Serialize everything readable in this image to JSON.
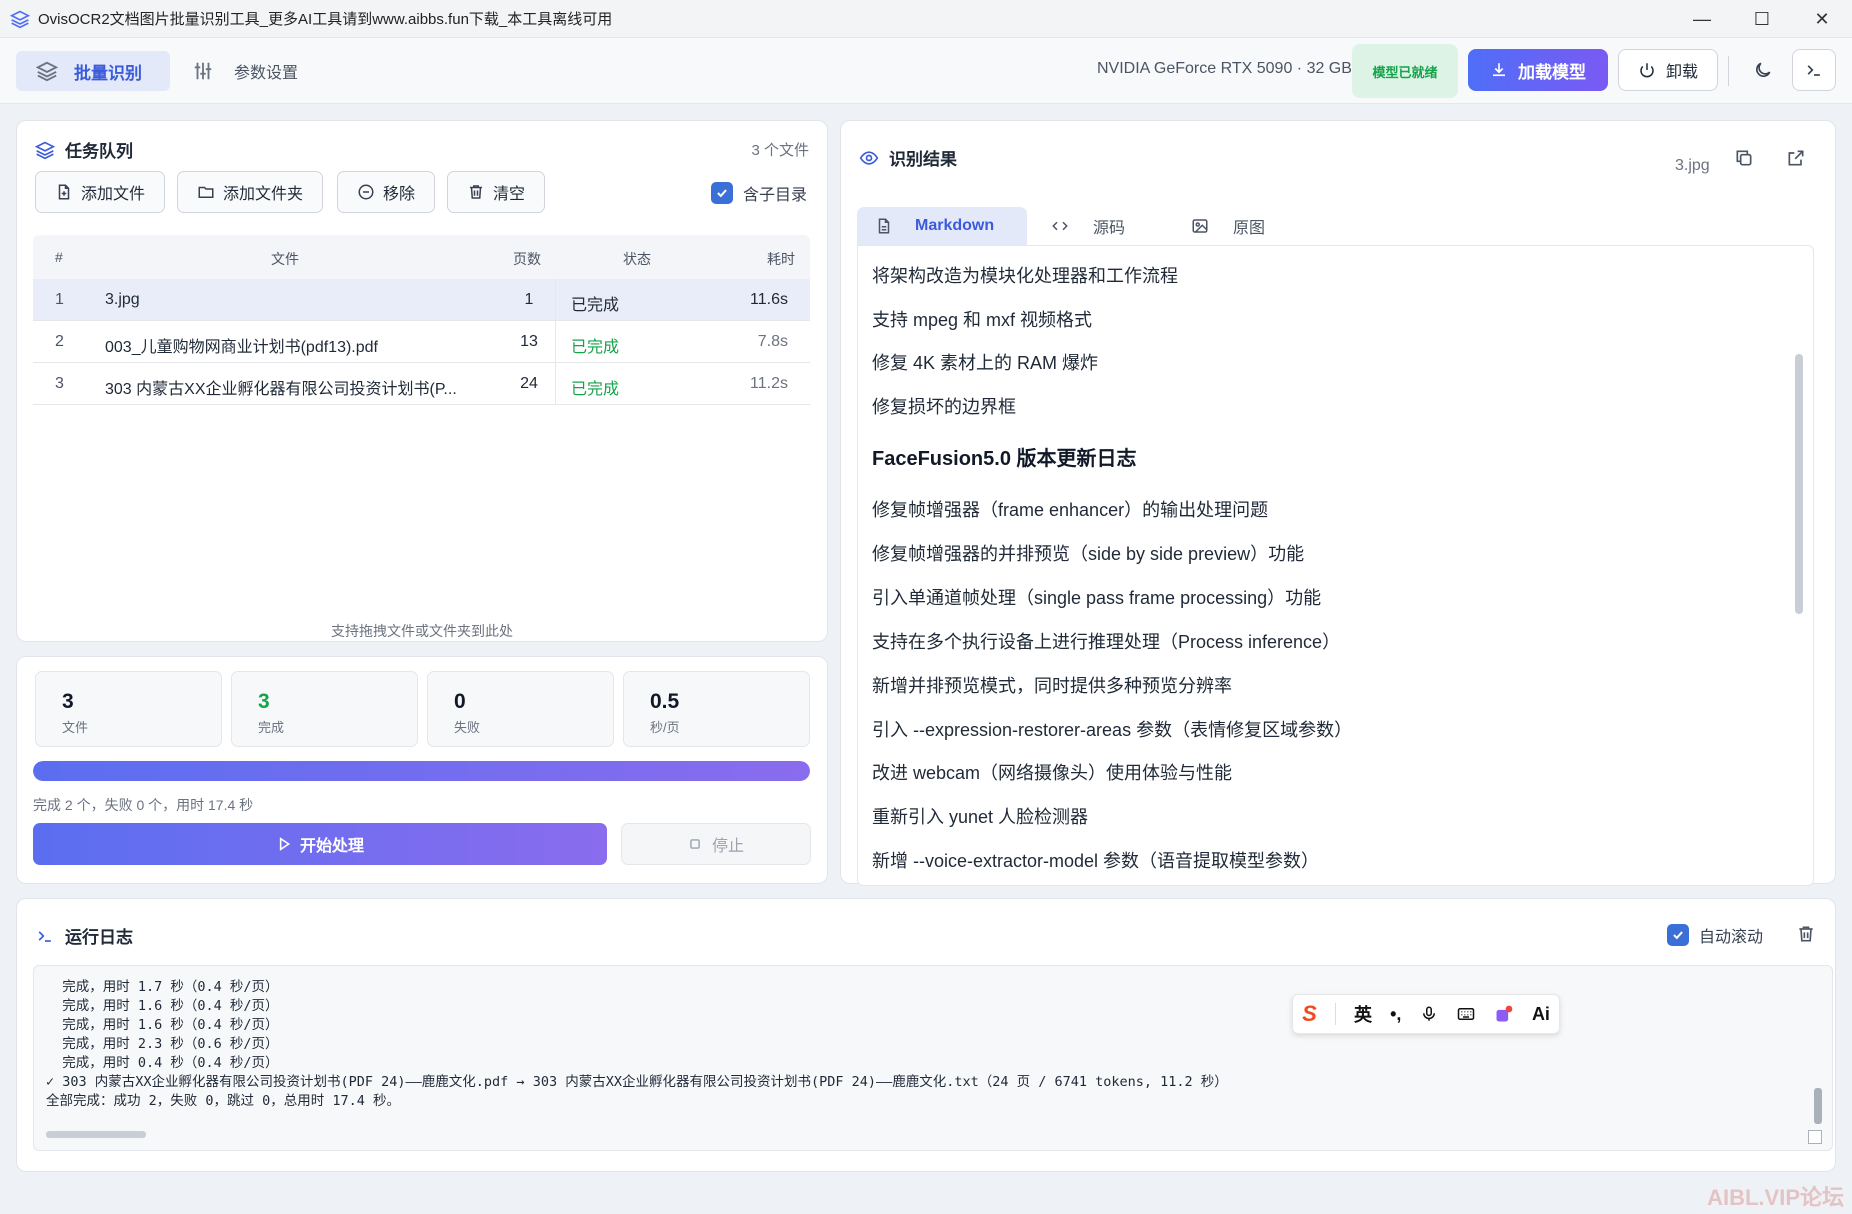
{
  "window": {
    "title": "OvisOCR2文档图片批量识别工具_更多AI工具请到www.aibbs.fun下载_本工具离线可用"
  },
  "topbar": {
    "nav": [
      {
        "label": "批量识别",
        "icon": "layers-icon",
        "active": true
      },
      {
        "label": "参数设置",
        "icon": "sliders-icon",
        "active": false
      }
    ],
    "gpu_info": "NVIDIA GeForce RTX 5090 · 32 GB",
    "model_status": "模型已就绪",
    "load_model_label": "加载模型",
    "unload_label": "卸载"
  },
  "queue": {
    "title": "任务队列",
    "file_count": "3 个文件",
    "buttons": {
      "add_file": "添加文件",
      "add_folder": "添加文件夹",
      "remove": "移除",
      "clear": "清空"
    },
    "include_subdirs": {
      "label": "含子目录",
      "checked": true
    },
    "columns": {
      "idx": "#",
      "file": "文件",
      "pages": "页数",
      "status": "状态",
      "time": "耗时"
    },
    "rows": [
      {
        "idx": "1",
        "file": "3.jpg",
        "pages": "1",
        "status": "已完成",
        "time": "11.6s",
        "selected": true
      },
      {
        "idx": "2",
        "file": "003_儿童购物网商业计划书(pdf13).pdf",
        "pages": "13",
        "status": "已完成",
        "time": "7.8s",
        "selected": false
      },
      {
        "idx": "3",
        "file": "303 内蒙古XX企业孵化器有限公司投资计划书(P...",
        "pages": "24",
        "status": "已完成",
        "time": "11.2s",
        "selected": false
      }
    ],
    "drop_hint": "支持拖拽文件或文件夹到此处"
  },
  "stats": {
    "cards": [
      {
        "value": "3",
        "caption": "文件"
      },
      {
        "value": "3",
        "caption": "完成"
      },
      {
        "value": "0",
        "caption": "失败"
      },
      {
        "value": "0.5",
        "caption": "秒/页"
      }
    ],
    "progress_percent": 100,
    "summary": "完成 2 个，失败 0 个，用时 17.4 秒",
    "start_label": "开始处理",
    "stop_label": "停止"
  },
  "result": {
    "title": "识别结果",
    "file": "3.jpg",
    "tabs": [
      {
        "label": "Markdown",
        "icon": "document-icon",
        "active": true
      },
      {
        "label": "源码",
        "icon": "code-icon",
        "active": false
      },
      {
        "label": "原图",
        "icon": "image-icon",
        "active": false
      }
    ],
    "lines": [
      "将架构改造为模块化处理器和工作流程",
      "支持 mpeg 和 mxf 视频格式",
      "修复 4K 素材上的 RAM 爆炸",
      "修复损坏的边界框"
    ],
    "heading": "FaceFusion5.0 版本更新日志",
    "lines2": [
      "修复帧增强器（frame enhancer）的输出处理问题",
      "修复帧增强器的并排预览（side by side preview）功能",
      "引入单通道帧处理（single pass frame processing）功能",
      "支持在多个执行设备上进行推理处理（Process inference）",
      "新增并排预览模式，同时提供多种预览分辨率",
      "引入 --expression-restorer-areas 参数（表情修复区域参数）",
      "改进 webcam（网络摄像头）使用体验与性能",
      "重新引入 yunet 人脸检测器",
      "新增 --voice-extractor-model 参数（语音提取模型参数）"
    ]
  },
  "log": {
    "title": "运行日志",
    "auto_scroll": {
      "label": "自动滚动",
      "checked": true
    },
    "lines": [
      "  完成，用时 1.7 秒（0.4 秒/页）",
      "  完成，用时 1.6 秒（0.4 秒/页）",
      "  完成，用时 1.6 秒（0.4 秒/页）",
      "  完成，用时 2.3 秒（0.6 秒/页）",
      "  完成，用时 0.4 秒（0.4 秒/页）",
      "✓ 303 内蒙古XX企业孵化器有限公司投资计划书(PDF 24)——鹿鹿文化.pdf → 303 内蒙古XX企业孵化器有限公司投资计划书(PDF 24)——鹿鹿文化.txt（24 页 / 6741 tokens, 11.2 秒）",
      "全部完成：成功 2，失败 0，跳过 0，总用时 17.4 秒。"
    ]
  },
  "ime": {
    "logo": "S",
    "lang": "英",
    "ai": "Ai"
  },
  "watermark": "AIBL.VIP论坛",
  "colors": {
    "accent": "#3b5bdb",
    "success": "#16a34a",
    "gradient_start": "#5b6ef0",
    "gradient_end": "#8a6cee"
  }
}
